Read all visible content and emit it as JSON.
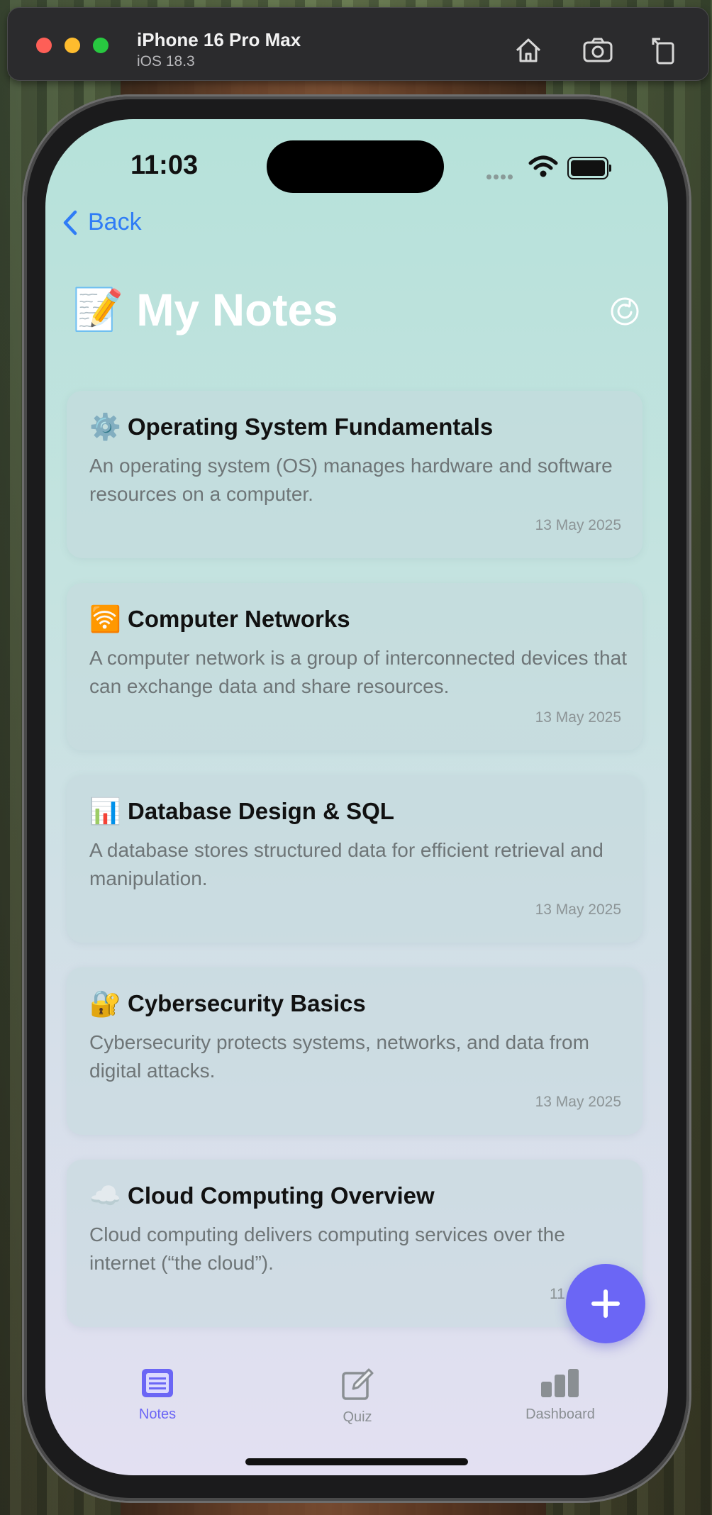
{
  "simulator": {
    "device": "iPhone 16 Pro Max",
    "os": "iOS 18.3",
    "icons": [
      "home-icon",
      "screenshot-icon",
      "rotate-icon"
    ],
    "lights": [
      "#fe5f57",
      "#febc2e",
      "#28c840"
    ]
  },
  "status": {
    "time": "11:03"
  },
  "nav": {
    "back_label": "Back"
  },
  "header": {
    "emoji": "📝",
    "title": "My Notes",
    "refresh_icon": "refresh-icon"
  },
  "notes": [
    {
      "icon": "⚙️",
      "title": "Operating System Fundamentals",
      "body": "An operating system (OS) manages hardware and software resources on a computer.",
      "date": "13 May 2025"
    },
    {
      "icon": "🛜",
      "title": "Computer Networks",
      "body": "A computer network is a group of interconnected devices that can exchange data and share resources.",
      "date": "13 May 2025"
    },
    {
      "icon": "📊",
      "title": "Database Design & SQL",
      "body": "A database stores structured data for efficient retrieval and manipulation.",
      "date": "13 May 2025"
    },
    {
      "icon": "🔐",
      "title": "Cybersecurity Basics",
      "body": "Cybersecurity protects systems, networks, and data from digital attacks.",
      "date": "13 May 2025"
    },
    {
      "icon": "☁️",
      "title": "Cloud Computing Overview",
      "body": "Cloud computing delivers computing services over the internet (“the cloud”).",
      "date": "11 Ma"
    }
  ],
  "fab": {
    "icon": "plus-icon"
  },
  "tabs": [
    {
      "label": "Notes",
      "icon": "notes-icon",
      "active": true
    },
    {
      "label": "Quiz",
      "icon": "edit-icon",
      "active": false
    },
    {
      "label": "Dashboard",
      "icon": "chart-icon",
      "active": false
    }
  ],
  "colors": {
    "accent": "#6b66f5",
    "link": "#2f7cf6",
    "inactive": "#8a8f93"
  }
}
